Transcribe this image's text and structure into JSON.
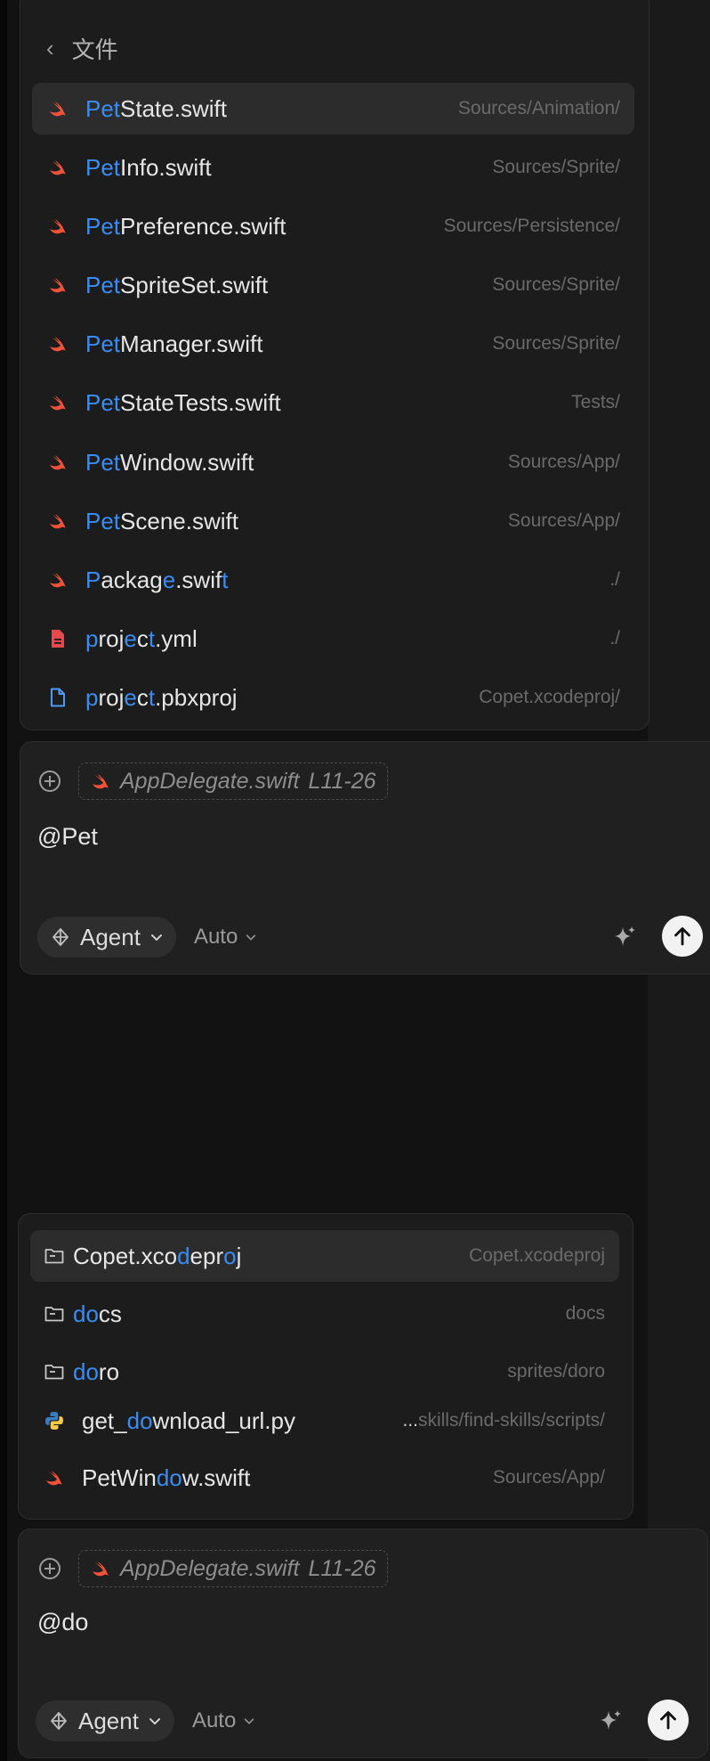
{
  "top_picker": {
    "back_label": "文件",
    "files": [
      {
        "pre": "",
        "hl": "Pet",
        "post": "State.swift",
        "path": "Sources/Animation/",
        "icon": "swift-icon"
      },
      {
        "pre": "",
        "hl": "Pet",
        "post": "Info.swift",
        "path": "Sources/Sprite/",
        "icon": "swift-icon"
      },
      {
        "pre": "",
        "hl": "Pet",
        "post": "Preference.swift",
        "path": "Sources/Persistence/",
        "icon": "swift-icon"
      },
      {
        "pre": "",
        "hl": "Pet",
        "post": "SpriteSet.swift",
        "path": "Sources/Sprite/",
        "icon": "swift-icon"
      },
      {
        "pre": "",
        "hl": "Pet",
        "post": "Manager.swift",
        "path": "Sources/Sprite/",
        "icon": "swift-icon"
      },
      {
        "pre": "",
        "hl": "Pet",
        "post": "StateTests.swift",
        "path": "Tests/",
        "icon": "swift-icon"
      },
      {
        "pre": "",
        "hl": "Pet",
        "post": "Window.swift",
        "path": "Sources/App/",
        "icon": "swift-icon"
      },
      {
        "pre": "",
        "hl": "Pet",
        "post": "Scene.swift",
        "path": "Sources/App/",
        "icon": "swift-icon"
      },
      {
        "segments": [
          [
            "P",
            1
          ],
          [
            "ackag",
            0
          ],
          [
            "e",
            1
          ],
          [
            ".swif",
            0
          ],
          [
            "t",
            1
          ]
        ],
        "path": "./",
        "icon": "swift-icon"
      },
      {
        "segments": [
          [
            "p",
            1
          ],
          [
            "roj",
            0
          ],
          [
            "e",
            1
          ],
          [
            "c",
            0
          ],
          [
            "t",
            1
          ],
          [
            ".yml",
            0
          ]
        ],
        "path": "./",
        "icon": "yaml-file-icon"
      },
      {
        "segments": [
          [
            "p",
            1
          ],
          [
            "roj",
            0
          ],
          [
            "e",
            1
          ],
          [
            "c",
            0
          ],
          [
            "t",
            1
          ],
          [
            ".pbxproj",
            0
          ]
        ],
        "path": "Copet.xcodeproj/",
        "icon": "document-icon"
      }
    ]
  },
  "composer_top": {
    "chip_file": "AppDelegate.swift",
    "chip_range": "L11-26",
    "query": "@Pet",
    "agent_label": "Agent",
    "model_label": "Auto"
  },
  "bottom_picker": {
    "items": [
      {
        "segments": [
          [
            "Copet.xco",
            0
          ],
          [
            "d",
            1
          ],
          [
            "epr",
            0
          ],
          [
            "o",
            1
          ],
          [
            "j",
            0
          ]
        ],
        "path": "Copet.xcodeproj",
        "icon": "folder-icon"
      },
      {
        "segments": [
          [
            "do",
            1
          ],
          [
            "cs",
            0
          ]
        ],
        "path": "docs",
        "icon": "folder-icon"
      },
      {
        "segments": [
          [
            "do",
            1
          ],
          [
            "ro",
            0
          ]
        ],
        "path": "sprites/doro",
        "icon": "folder-icon"
      },
      {
        "segments": [
          [
            "get_",
            0
          ],
          [
            "do",
            1
          ],
          [
            "wnload_url.py",
            0
          ]
        ],
        "path_prefix": "...",
        "path": "skills/find-skills/scripts/",
        "icon": "python-icon"
      },
      {
        "segments": [
          [
            "PetWin",
            0
          ],
          [
            "do",
            1
          ],
          [
            "w.swift",
            0
          ]
        ],
        "path": "Sources/App/",
        "icon": "swift-icon"
      }
    ]
  },
  "composer_bottom": {
    "chip_file": "AppDelegate.swift",
    "chip_range": "L11-26",
    "query": "@do",
    "agent_label": "Agent",
    "model_label": "Auto"
  },
  "colors": {
    "highlight": "#3b8cf2",
    "swift": "#f05138",
    "yaml": "#e5484d",
    "doc": "#4c9bf5"
  }
}
